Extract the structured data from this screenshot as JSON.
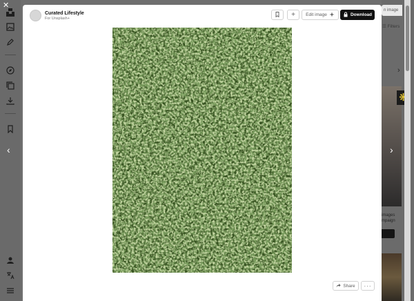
{
  "modal": {
    "author_name": "Curated Lifestyle",
    "author_subtitle": "For Unsplash+",
    "add_label": "+",
    "edit_label": "Edit image",
    "download_label": "Download",
    "share_label": "Share",
    "more_label": "···",
    "image_alt": "Dried green herbs"
  },
  "background": {
    "close_label": "✕",
    "search_pill": "n image",
    "filters_label": "Filters",
    "promo_text": [
      "images",
      "mpaign"
    ],
    "prev_arrow": "‹",
    "next_arrow": "›",
    "pinwheel": "❋"
  },
  "icons": {
    "bookmark": "bookmark-icon",
    "edit": "sparkle-icon",
    "download": "lock-icon",
    "share": "share-arrow-icon"
  }
}
